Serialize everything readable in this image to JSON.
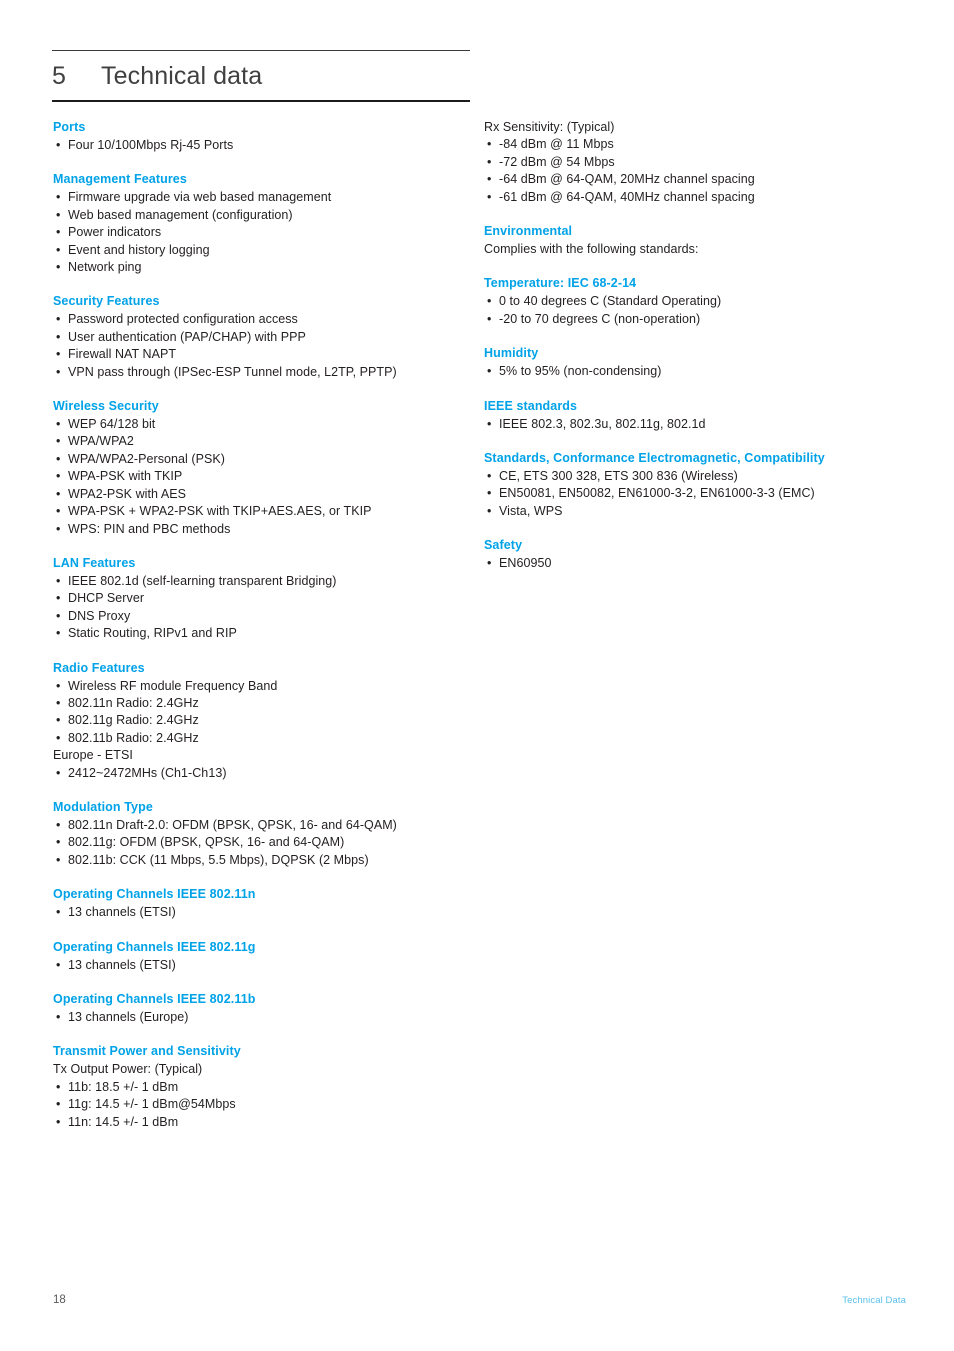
{
  "document": {
    "chapter_number": "5",
    "chapter_title": "Technical data",
    "accent_color": "#00a2e8",
    "footer_accent_color": "#5bc0eb",
    "body_color": "#231f20"
  },
  "left_column": [
    {
      "heading": "Ports",
      "note": null,
      "items": [
        "Four 10/100Mbps Rj-45 Ports"
      ]
    },
    {
      "heading": "Management Features",
      "note": null,
      "items": [
        "Firmware upgrade via web based management",
        "Web based management (configuration)",
        "Power indicators",
        "Event and history logging",
        "Network ping"
      ]
    },
    {
      "heading": "Security Features",
      "note": null,
      "items": [
        "Password protected configuration access",
        "User authentication (PAP/CHAP) with PPP",
        "Firewall NAT NAPT",
        "VPN pass through (IPSec-ESP Tunnel mode, L2TP, PPTP)"
      ]
    },
    {
      "heading": "Wireless Security",
      "note": null,
      "items": [
        "WEP 64/128 bit",
        "WPA/WPA2",
        "WPA/WPA2-Personal (PSK)",
        "WPA-PSK with TKIP",
        "WPA2-PSK with AES",
        "WPA-PSK + WPA2-PSK with TKIP+AES.AES, or TKIP",
        "WPS: PIN and PBC methods"
      ]
    },
    {
      "heading": "LAN Features",
      "note": null,
      "items": [
        "IEEE 802.1d (self-learning transparent Bridging)",
        "DHCP Server",
        "DNS Proxy",
        "Static Routing, RIPv1 and RIP"
      ]
    },
    {
      "heading": "Radio Features",
      "note": null,
      "items": [
        "Wireless RF module Frequency Band",
        "802.11n Radio: 2.4GHz",
        "802.11g Radio: 2.4GHz",
        "802.11b Radio: 2.4GHz"
      ],
      "mid_note": "Europe - ETSI",
      "items_after": [
        "2412~2472MHs (Ch1-Ch13)"
      ]
    },
    {
      "heading": "Modulation Type",
      "note": null,
      "items": [
        "802.11n Draft-2.0: OFDM (BPSK, QPSK, 16- and 64-QAM)",
        "802.11g: OFDM (BPSK, QPSK, 16- and 64-QAM)",
        "802.11b: CCK (11 Mbps, 5.5 Mbps), DQPSK (2 Mbps)"
      ]
    },
    {
      "heading": "Operating Channels IEEE 802.11n",
      "note": null,
      "items": [
        "13 channels (ETSI)"
      ]
    },
    {
      "heading": "Operating Channels IEEE 802.11g",
      "note": null,
      "items": [
        "13 channels (ETSI)"
      ]
    },
    {
      "heading": "Operating Channels IEEE 802.11b",
      "note": null,
      "items": [
        "13 channels (Europe)"
      ]
    },
    {
      "heading": "Transmit Power and Sensitivity",
      "note": "Tx Output Power: (Typical)",
      "items": [
        "11b: 18.5 +/- 1 dBm",
        "11g: 14.5 +/- 1 dBm@54Mbps",
        "11n: 14.5 +/- 1 dBm"
      ]
    }
  ],
  "right_column": [
    {
      "heading": null,
      "note": "Rx Sensitivity: (Typical)",
      "items": [
        "-84 dBm @ 11 Mbps",
        "-72 dBm @ 54 Mbps",
        "-64 dBm @ 64-QAM, 20MHz channel spacing",
        "-61 dBm @ 64-QAM, 40MHz channel spacing"
      ]
    },
    {
      "heading": "Environmental",
      "note": "Complies with the following standards:",
      "items": []
    },
    {
      "heading": "Temperature: IEC 68-2-14",
      "note": null,
      "items": [
        "0 to 40 degrees C (Standard Operating)",
        "-20 to 70 degrees C (non-operation)"
      ]
    },
    {
      "heading": "Humidity",
      "note": null,
      "items": [
        "5% to 95% (non-condensing)"
      ]
    },
    {
      "heading": "IEEE standards",
      "note": null,
      "items": [
        "IEEE 802.3, 802.3u, 802.11g, 802.1d"
      ]
    },
    {
      "heading": "Standards, Conformance Electromagnetic, Compatibility",
      "note": null,
      "items": [
        "CE, ETS 300 328, ETS 300 836 (Wireless)",
        "EN50081, EN50082, EN61000-3-2, EN61000-3-3 (EMC)",
        "Vista, WPS"
      ]
    },
    {
      "heading": "Safety",
      "note": null,
      "items": [
        "EN60950"
      ]
    }
  ],
  "footer": {
    "page_number": "18",
    "label": "Technical Data"
  },
  "bullet_glyph": "•"
}
